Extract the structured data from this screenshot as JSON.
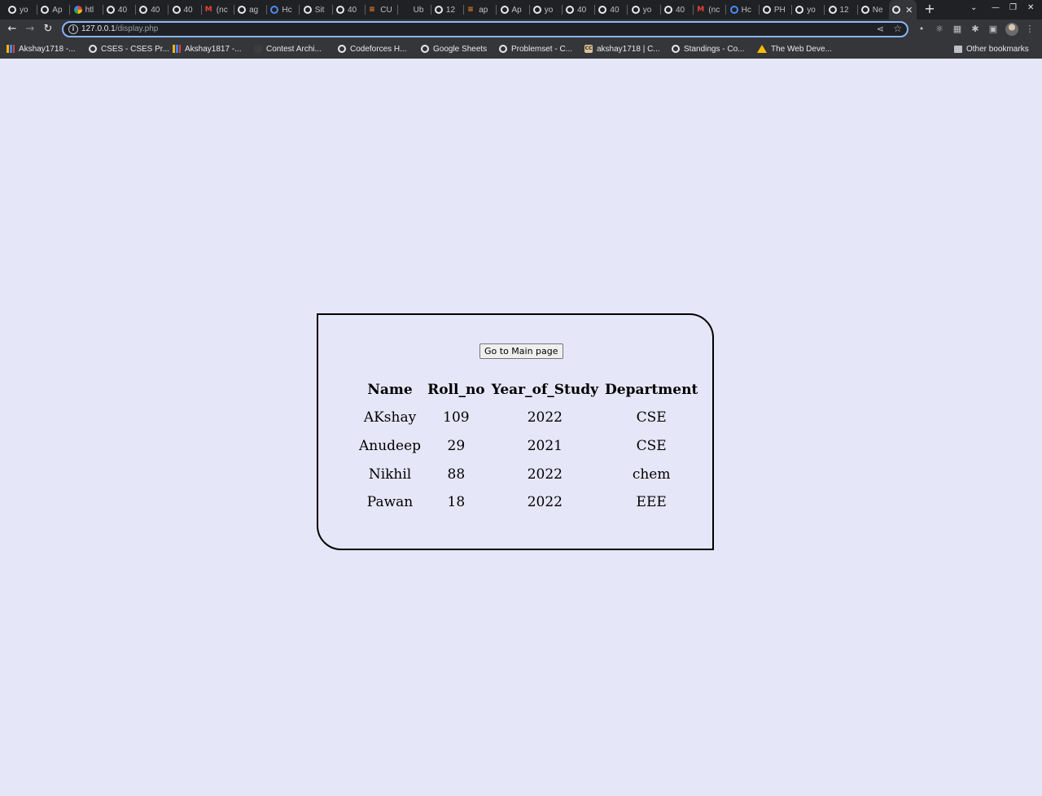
{
  "browser": {
    "tabs": [
      {
        "title": "yo",
        "icon": "globe-icon"
      },
      {
        "title": "Ap",
        "icon": "globe-icon"
      },
      {
        "title": "htl",
        "icon": "google-icon"
      },
      {
        "title": "40",
        "icon": "globe-icon"
      },
      {
        "title": "40",
        "icon": "globe-icon"
      },
      {
        "title": "40",
        "icon": "globe-icon"
      },
      {
        "title": "(nc",
        "icon": "gmail-icon"
      },
      {
        "title": "ag",
        "icon": "globe-icon"
      },
      {
        "title": "Hc",
        "icon": "hackerrank-icon"
      },
      {
        "title": "Sit",
        "icon": "globe-icon"
      },
      {
        "title": "40",
        "icon": "globe-icon"
      },
      {
        "title": "CU",
        "icon": "stackoverflow-icon"
      },
      {
        "title": "Ub",
        "icon": "blank-icon"
      },
      {
        "title": "12",
        "icon": "globe-icon"
      },
      {
        "title": "ap",
        "icon": "stackoverflow-icon"
      },
      {
        "title": "Ap",
        "icon": "globe-icon"
      },
      {
        "title": "yo",
        "icon": "globe-icon"
      },
      {
        "title": "40",
        "icon": "globe-icon"
      },
      {
        "title": "40",
        "icon": "globe-icon"
      },
      {
        "title": "yo",
        "icon": "globe-icon"
      },
      {
        "title": "40",
        "icon": "globe-icon"
      },
      {
        "title": "(nc",
        "icon": "gmail-icon"
      },
      {
        "title": "Hc",
        "icon": "hackerrank-icon"
      },
      {
        "title": "PH",
        "icon": "globe-icon"
      },
      {
        "title": "yo",
        "icon": "globe-icon"
      },
      {
        "title": "12",
        "icon": "globe-icon"
      },
      {
        "title": "Ne",
        "icon": "globe-icon"
      }
    ],
    "active_tab_close": "✕",
    "new_tab": "+",
    "url_host": "127.0.0.1",
    "url_path": "/display.php",
    "bookmarks": [
      {
        "label": "Akshay1718 -...",
        "icon": "bars"
      },
      {
        "label": "CSES - CSES Pr...",
        "icon": "globe"
      },
      {
        "label": "Akshay1817 -...",
        "icon": "bars"
      },
      {
        "label": "Contest Archi...",
        "icon": "dark"
      },
      {
        "label": "Codeforces H...",
        "icon": "globe"
      },
      {
        "label": "Google Sheets",
        "icon": "globe"
      },
      {
        "label": "Problemset - C...",
        "icon": "globe"
      },
      {
        "label": "akshay1718 | C...",
        "icon": "cc"
      },
      {
        "label": "Standings - Co...",
        "icon": "globe"
      },
      {
        "label": "The Web Deve...",
        "icon": "drive"
      }
    ],
    "other_bookmarks": "Other bookmarks"
  },
  "page": {
    "main_button_label": "Go to Main page",
    "table": {
      "headers": [
        "Name",
        "Roll_no",
        "Year_of_Study",
        "Department"
      ],
      "rows": [
        [
          "AKshay",
          "109",
          "2022",
          "CSE"
        ],
        [
          "Anudeep",
          "29",
          "2021",
          "CSE"
        ],
        [
          "Nikhil",
          "88",
          "2022",
          "chem"
        ],
        [
          "Pawan",
          "18",
          "2022",
          "EEE"
        ]
      ]
    }
  },
  "colors": {
    "page_background": "#e6e6f9",
    "chrome_dark": "#202124",
    "chrome_toolbar": "#35363a",
    "omnibox_focus": "#8ab4f8"
  }
}
